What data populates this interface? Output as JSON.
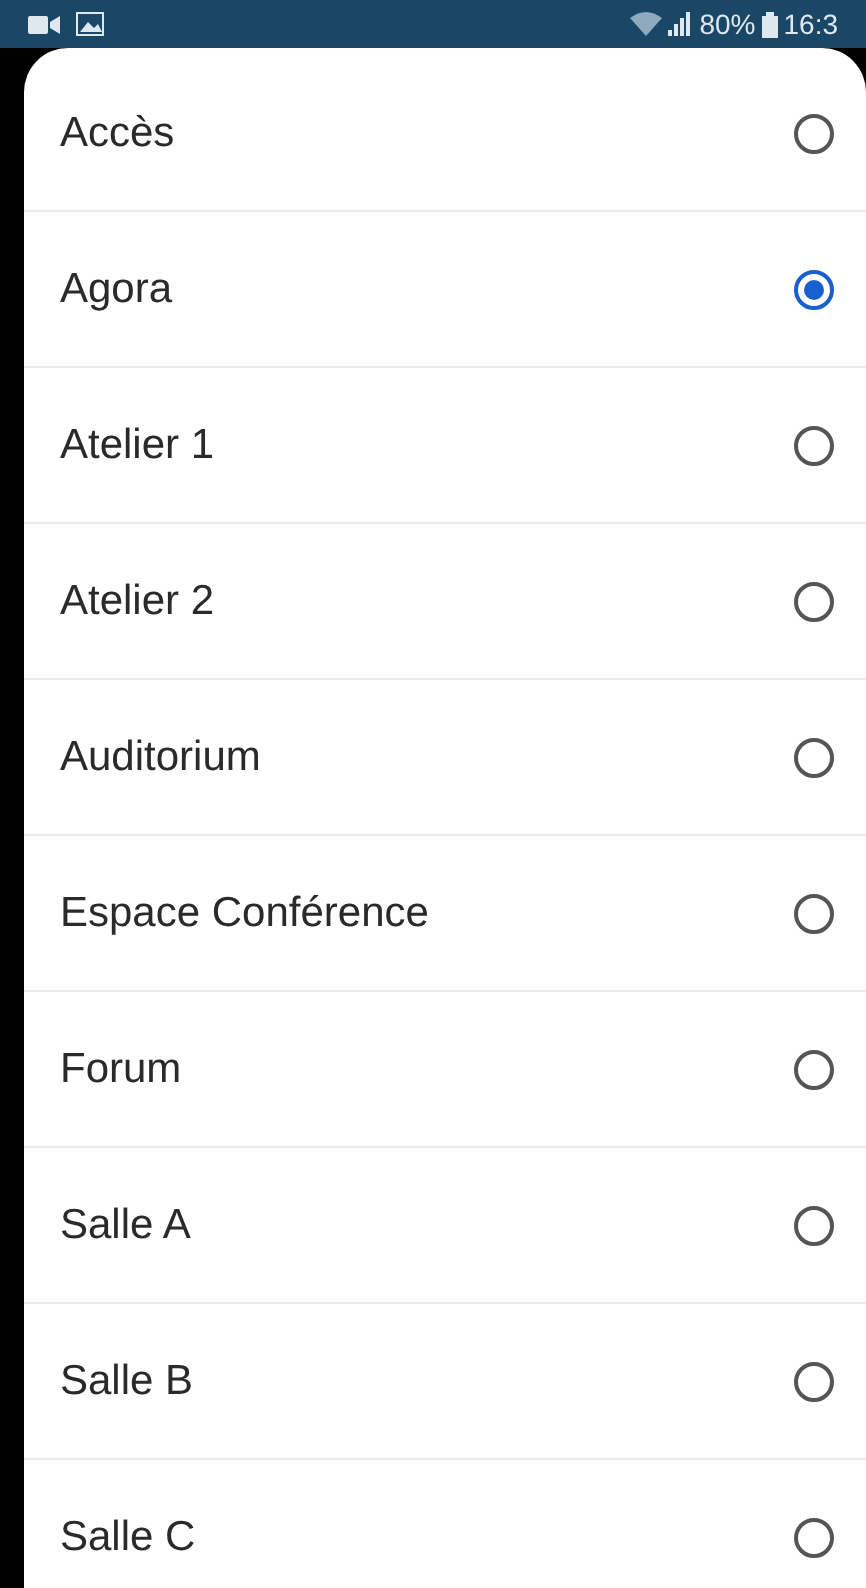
{
  "status_bar": {
    "battery": "80%",
    "time": "16:3"
  },
  "options": [
    {
      "label": "Accès",
      "selected": false
    },
    {
      "label": "Agora",
      "selected": true
    },
    {
      "label": "Atelier 1",
      "selected": false
    },
    {
      "label": "Atelier 2",
      "selected": false
    },
    {
      "label": "Auditorium",
      "selected": false
    },
    {
      "label": "Espace Conférence",
      "selected": false
    },
    {
      "label": "Forum",
      "selected": false
    },
    {
      "label": "Salle A",
      "selected": false
    },
    {
      "label": "Salle B",
      "selected": false
    },
    {
      "label": "Salle C",
      "selected": false
    }
  ]
}
